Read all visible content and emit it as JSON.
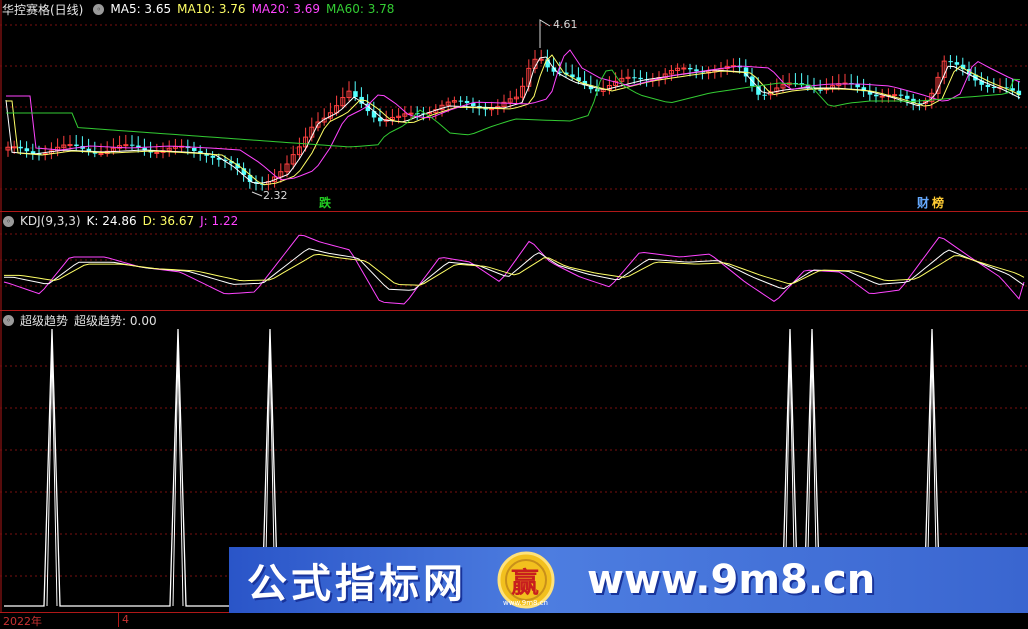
{
  "main_pane": {
    "title": "华控赛格(日线)",
    "ma5_label": "MA5: 3.65",
    "ma10_label": "MA10: 3.76",
    "ma20_label": "MA20: 3.69",
    "ma60_label": "MA60: 3.78",
    "high_annotation": "4.61",
    "low_annotation": "2.32",
    "tag_die": "跌",
    "tag_cai": "财",
    "tag_bang": "榜",
    "colors": {
      "ma5": "#ffffff",
      "ma10": "#ffff66",
      "ma20": "#ff44ff",
      "ma60": "#33cc33",
      "up": "#ff4040",
      "down": "#54ffff"
    }
  },
  "kdj_pane": {
    "title": "KDJ(9,3,3)",
    "k_label": "K: 24.86",
    "d_label": "D: 36.67",
    "j_label": "J: 1.22"
  },
  "trend_pane": {
    "title": "超级趋势",
    "value_label": "超级趋势: 0.00"
  },
  "time_axis": {
    "year_label": "2022年",
    "month_label": "4"
  },
  "watermark": {
    "text_cn": "公式指标网",
    "logo_text": "赢",
    "logo_sub": "www.9m8.cn",
    "url": "www.9m8.cn"
  }
}
